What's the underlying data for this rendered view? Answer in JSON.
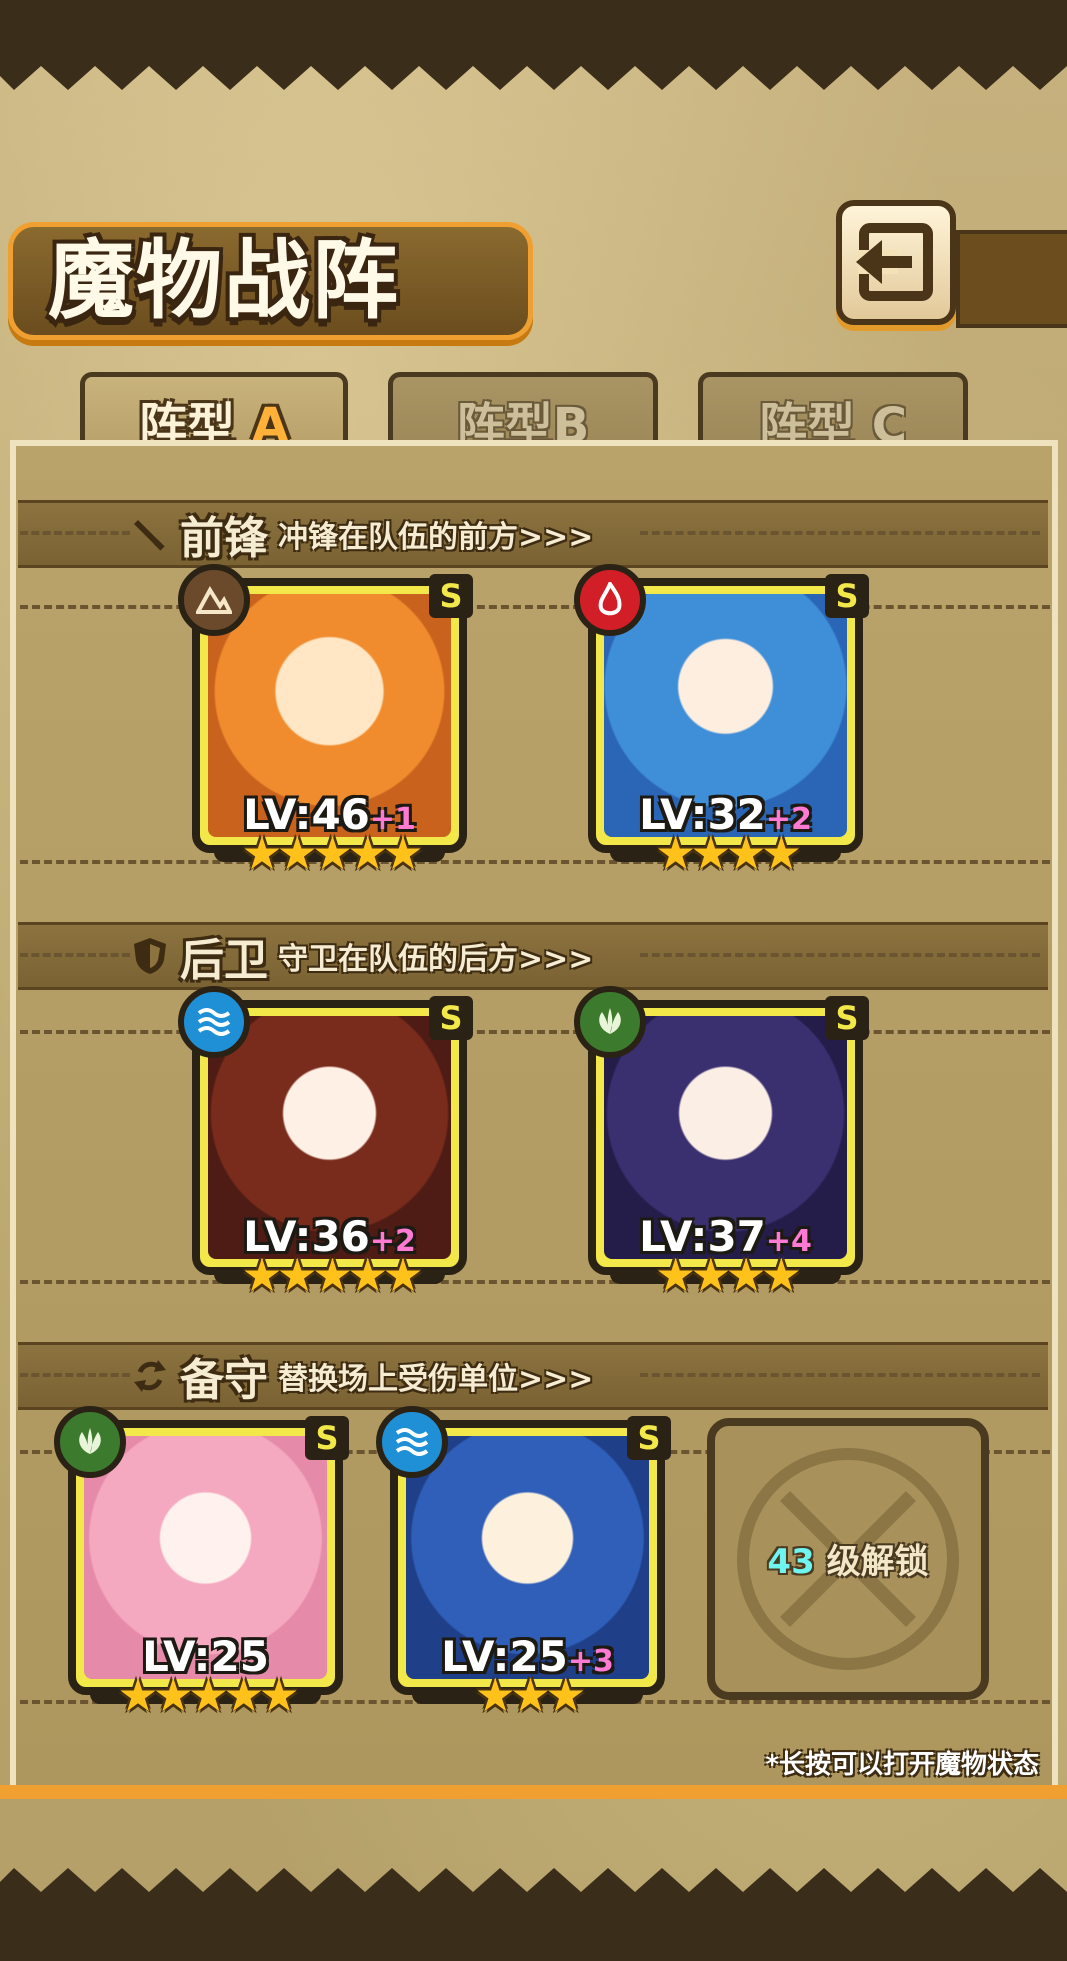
{
  "title": "魔物战阵",
  "tabs": [
    {
      "prefix": "阵型",
      "letter": "A",
      "active": true
    },
    {
      "prefix": "阵型",
      "letter": "B",
      "active": false
    },
    {
      "prefix": "阵型",
      "letter": "C",
      "active": false
    }
  ],
  "sections": {
    "front": {
      "name": "前锋",
      "desc": "冲锋在队伍的前方>>>",
      "icon": "sword-icon"
    },
    "back": {
      "name": "后卫",
      "desc": "守卫在队伍的后方>>>",
      "icon": "shield-icon"
    },
    "reserve": {
      "name": "备守",
      "desc": "替换场上受伤单位>>>",
      "icon": "swap-icon"
    }
  },
  "cards": {
    "front1": {
      "lv": "LV:46",
      "plus": "+1",
      "stars": 5,
      "stars_text": "★★★★★",
      "rank": "S",
      "element": "earth-icon",
      "element_color": "#6b4a2c"
    },
    "front2": {
      "lv": "LV:32",
      "plus": "+2",
      "stars": 4,
      "stars_text": "★★★★",
      "rank": "S",
      "element": "fire-icon",
      "element_color": "#d21e26"
    },
    "back1": {
      "lv": "LV:36",
      "plus": "+2",
      "stars": 5,
      "stars_text": "★★★★★",
      "rank": "S",
      "element": "water-icon",
      "element_color": "#1f8fd6"
    },
    "back2": {
      "lv": "LV:37",
      "plus": "+4",
      "stars": 4,
      "stars_text": "★★★★",
      "rank": "S",
      "element": "wood-icon",
      "element_color": "#3c7a2e"
    },
    "reserve1": {
      "lv": "LV:25",
      "plus": "",
      "stars": 5,
      "stars_text": "★★★★★",
      "rank": "S",
      "element": "wood-icon",
      "element_color": "#3c7a2e"
    },
    "reserve2": {
      "lv": "LV:25",
      "plus": "+3",
      "stars": 3,
      "stars_text": "★★★",
      "rank": "S",
      "element": "water-icon",
      "element_color": "#1f8fd6"
    }
  },
  "locked_slot": {
    "level": "43",
    "text": "级解锁"
  },
  "hint": "*长按可以打开魔物状态",
  "colors": {
    "accent": "#f0a030",
    "card_border": "#f2e84a",
    "plus": "#ff7ad3"
  }
}
